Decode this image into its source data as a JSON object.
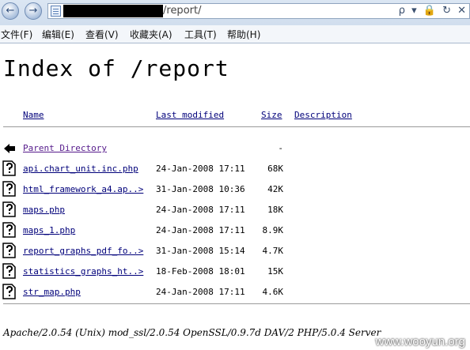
{
  "browser": {
    "url_visible": "/report/",
    "menu": [
      "文件(F)",
      "编辑(E)",
      "查看(V)",
      "收藏夹(A)",
      "工具(T)",
      "帮助(H)"
    ],
    "address_tools": "ρ ▾ 🔒 ↻ ✕"
  },
  "page": {
    "title": "Index of /report",
    "headers": {
      "name": "Name",
      "modified": "Last modified",
      "size": "Size",
      "description": "Description"
    },
    "parent": {
      "name": "Parent Directory",
      "size": "-"
    },
    "files": [
      {
        "name": "api.chart_unit.inc.php",
        "modified": "24-Jan-2008 17:11",
        "size": "68K"
      },
      {
        "name": "html_framework_a4.ap..>",
        "modified": "31-Jan-2008 10:36",
        "size": "42K"
      },
      {
        "name": "maps.php",
        "modified": "24-Jan-2008 17:11",
        "size": "18K"
      },
      {
        "name": "maps_1.php",
        "modified": "24-Jan-2008 17:11",
        "size": "8.9K"
      },
      {
        "name": "report_graphs_pdf_fo..>",
        "modified": "31-Jan-2008 15:14",
        "size": "4.7K"
      },
      {
        "name": "statistics_graphs_ht..>",
        "modified": "18-Feb-2008 18:01",
        "size": "15K"
      },
      {
        "name": "str_map.php",
        "modified": "24-Jan-2008 17:11",
        "size": "4.6K"
      }
    ],
    "server_signature": "Apache/2.0.54 (Unix) mod_ssl/2.0.54 OpenSSL/0.9.7d DAV/2 PHP/5.0.4 Server",
    "watermark": "www.wooyun.org"
  },
  "colors": {
    "link": "#00007a",
    "visited": "#551a8b"
  }
}
